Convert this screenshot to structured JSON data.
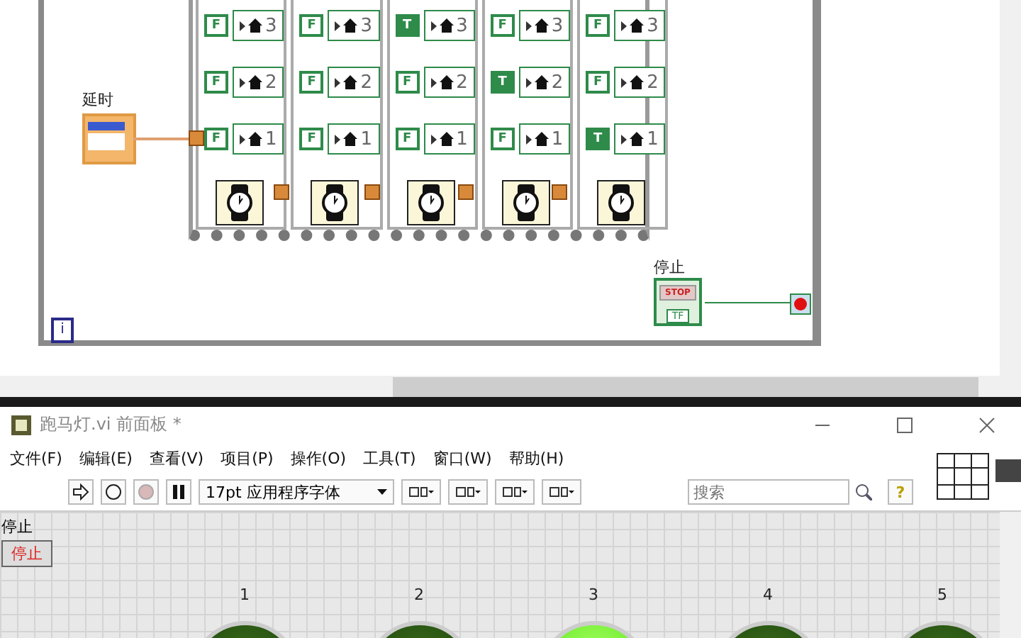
{
  "block_diagram": {
    "delay_control": {
      "label": "延时"
    },
    "sequence_frames": [
      {
        "rows": [
          {
            "value": "F",
            "on": false,
            "index": "3"
          },
          {
            "value": "F",
            "on": false,
            "index": "2"
          },
          {
            "value": "F",
            "on": false,
            "index": "1"
          }
        ]
      },
      {
        "rows": [
          {
            "value": "F",
            "on": false,
            "index": "3"
          },
          {
            "value": "F",
            "on": false,
            "index": "2"
          },
          {
            "value": "F",
            "on": false,
            "index": "1"
          }
        ]
      },
      {
        "rows": [
          {
            "value": "T",
            "on": true,
            "index": "3"
          },
          {
            "value": "F",
            "on": false,
            "index": "2"
          },
          {
            "value": "F",
            "on": false,
            "index": "1"
          }
        ]
      },
      {
        "rows": [
          {
            "value": "F",
            "on": false,
            "index": "3"
          },
          {
            "value": "T",
            "on": true,
            "index": "2"
          },
          {
            "value": "F",
            "on": false,
            "index": "1"
          }
        ]
      },
      {
        "rows": [
          {
            "value": "F",
            "on": false,
            "index": "3"
          },
          {
            "value": "F",
            "on": false,
            "index": "2"
          },
          {
            "value": "T",
            "on": true,
            "index": "1"
          }
        ]
      }
    ],
    "stop_control": {
      "label": "停止",
      "button_text": "STOP",
      "terminal_text": "TF"
    },
    "iteration_terminal": "i"
  },
  "front_panel": {
    "title": "跑马灯.vi 前面板 *",
    "menu": [
      "文件(F)",
      "编辑(E)",
      "查看(V)",
      "项目(P)",
      "操作(O)",
      "工具(T)",
      "窗口(W)",
      "帮助(H)"
    ],
    "font_selector": "17pt 应用程序字体",
    "search": {
      "placeholder": "搜索"
    },
    "help_button": "?",
    "stop_button": {
      "label": "停止",
      "text": "停止"
    },
    "leds": [
      {
        "label": "1",
        "on": false
      },
      {
        "label": "2",
        "on": false
      },
      {
        "label": "3",
        "on": true
      },
      {
        "label": "4",
        "on": false
      },
      {
        "label": "5",
        "on": false
      }
    ]
  }
}
